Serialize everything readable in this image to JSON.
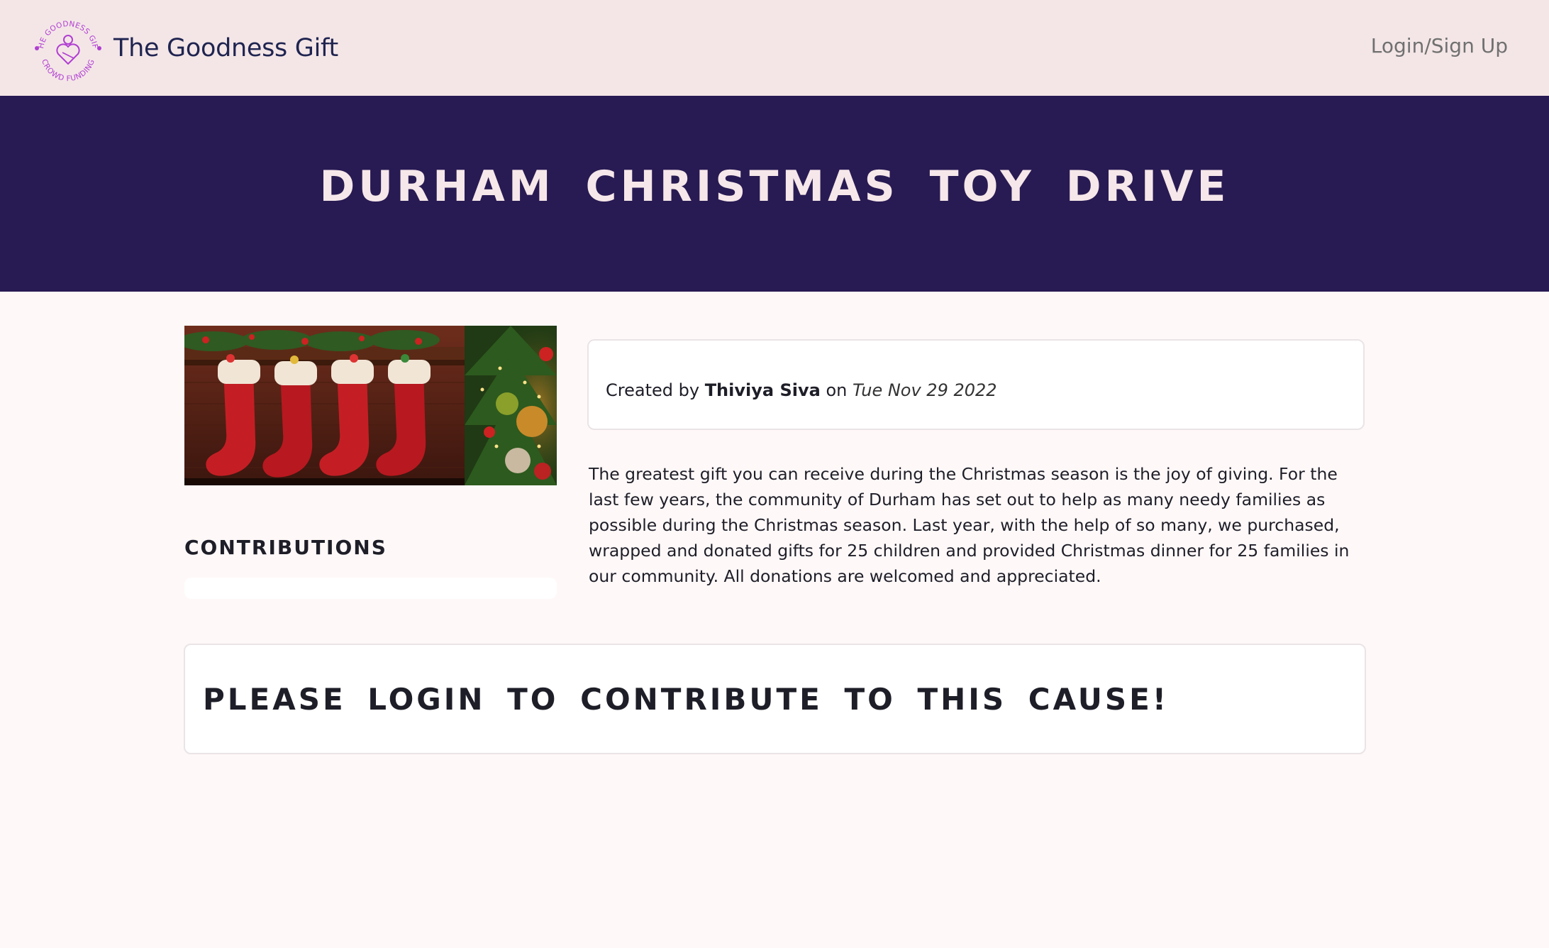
{
  "navbar": {
    "brand_name": "The Goodness Gift",
    "logo_text_top": "THE GOODNESS GIFT",
    "logo_text_bottom": "CROWD FUNDING",
    "login_label": "Login/Sign Up"
  },
  "hero": {
    "title": "DURHAM CHRISTMAS TOY DRIVE"
  },
  "campaign": {
    "image_alt": "Christmas stockings hanging on a mantel beside a decorated tree",
    "created_by_prefix": "Created by",
    "creator_name": "Thiviya Siva",
    "on_label": "on",
    "created_date": "Tue Nov 29 2022",
    "description": "The greatest gift you can receive during the Christmas season is the joy of giving. For the last few years, the community of Durham has set out to help as many needy families as possible during the Christmas season. Last year, with the help of so many, we purchased, wrapped and donated gifts for 25 children and provided Christmas dinner for 25 families in our community. All donations are welcomed and appreciated."
  },
  "contributions": {
    "heading": "CONTRIBUTIONS"
  },
  "login_prompt": {
    "text": "PLEASE LOGIN TO CONTRIBUTE TO THIS CAUSE!"
  },
  "colors": {
    "navbar_bg": "#f4e6e7",
    "hero_bg": "#281a52",
    "hero_text": "#f6e7ea",
    "page_bg": "#fff8f8",
    "logo_purple": "#b03fd1",
    "brand_text": "#1f2450"
  }
}
